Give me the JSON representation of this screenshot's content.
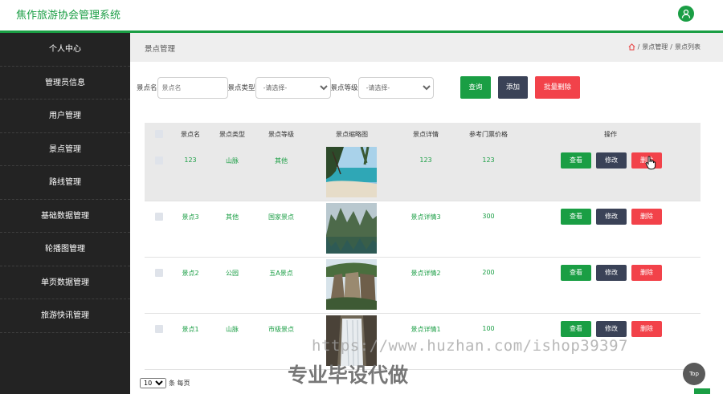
{
  "app": {
    "title": "焦作旅游协会管理系统"
  },
  "sidebar": {
    "items": [
      {
        "label": "个人中心"
      },
      {
        "label": "管理员信息"
      },
      {
        "label": "用户管理"
      },
      {
        "label": "景点管理"
      },
      {
        "label": "路线管理"
      },
      {
        "label": "基础数据管理"
      },
      {
        "label": "轮播图管理"
      },
      {
        "label": "单页数据管理"
      },
      {
        "label": "旅游快讯管理"
      }
    ]
  },
  "header": {
    "heading": "景点管理",
    "breadcrumb": [
      "景点管理",
      "景点列表"
    ],
    "separator": "/"
  },
  "search": {
    "name_label": "景点名",
    "name_placeholder": "景点名",
    "type_label": "景点类型",
    "type_selected": "-请选择-",
    "level_label": "景点等级",
    "level_selected": "-请选择-",
    "query_label": "查询",
    "add_label": "添加",
    "batch_delete_label": "批量删除"
  },
  "table": {
    "columns": [
      "景点名",
      "景点类型",
      "景点等级",
      "景点缩略图",
      "景点详情",
      "参考门票价格",
      "操作"
    ],
    "actions": {
      "view": "查看",
      "edit": "修改",
      "delete": "删除"
    },
    "rows": [
      {
        "name": "123",
        "type": "山脉",
        "level": "其他",
        "image": "beach",
        "detail": "123",
        "price": "123"
      },
      {
        "name": "景点3",
        "type": "其他",
        "level": "国家景点",
        "image": "karst-lake",
        "detail": "景点详情3",
        "price": "300"
      },
      {
        "name": "景点2",
        "type": "公园",
        "level": "五A景点",
        "image": "cliff",
        "detail": "景点详情2",
        "price": "200"
      },
      {
        "name": "景点1",
        "type": "山脉",
        "level": "市级景点",
        "image": "waterfall",
        "detail": "景点详情1",
        "price": "100"
      }
    ]
  },
  "pager": {
    "page_size": "10",
    "suffix": "条 每页"
  },
  "watermark": {
    "url": "https://www.huzhan.com/ishop39397",
    "slogan": "专业毕设代做"
  },
  "top_button": "Top",
  "colors": {
    "accent": "#1a9e44",
    "dark": "#3a4257",
    "danger": "#f2424a",
    "sidebar": "#232323"
  }
}
